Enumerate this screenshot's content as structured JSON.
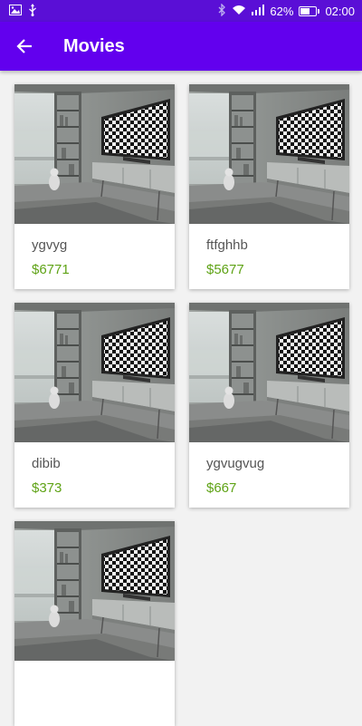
{
  "status": {
    "battery": "62%",
    "battery_level": 0.62,
    "time": "02:00"
  },
  "app_bar": {
    "title": "Movies",
    "back_icon": "arrow-back-icon",
    "color": "#6200ee"
  },
  "colors": {
    "status_bar": "#5a0fd6",
    "price": "#5fa316"
  },
  "movies": [
    {
      "name": "ygvyg",
      "price": "$6771",
      "image": "tv-room-thumbnail"
    },
    {
      "name": "ftfghhb",
      "price": "$5677",
      "image": "tv-room-thumbnail"
    },
    {
      "name": "dibib",
      "price": "$373",
      "image": "tv-room-thumbnail"
    },
    {
      "name": "ygvugvug",
      "price": "$667",
      "image": "tv-room-thumbnail"
    },
    {
      "name": "",
      "price": "",
      "image": "tv-room-thumbnail"
    }
  ]
}
